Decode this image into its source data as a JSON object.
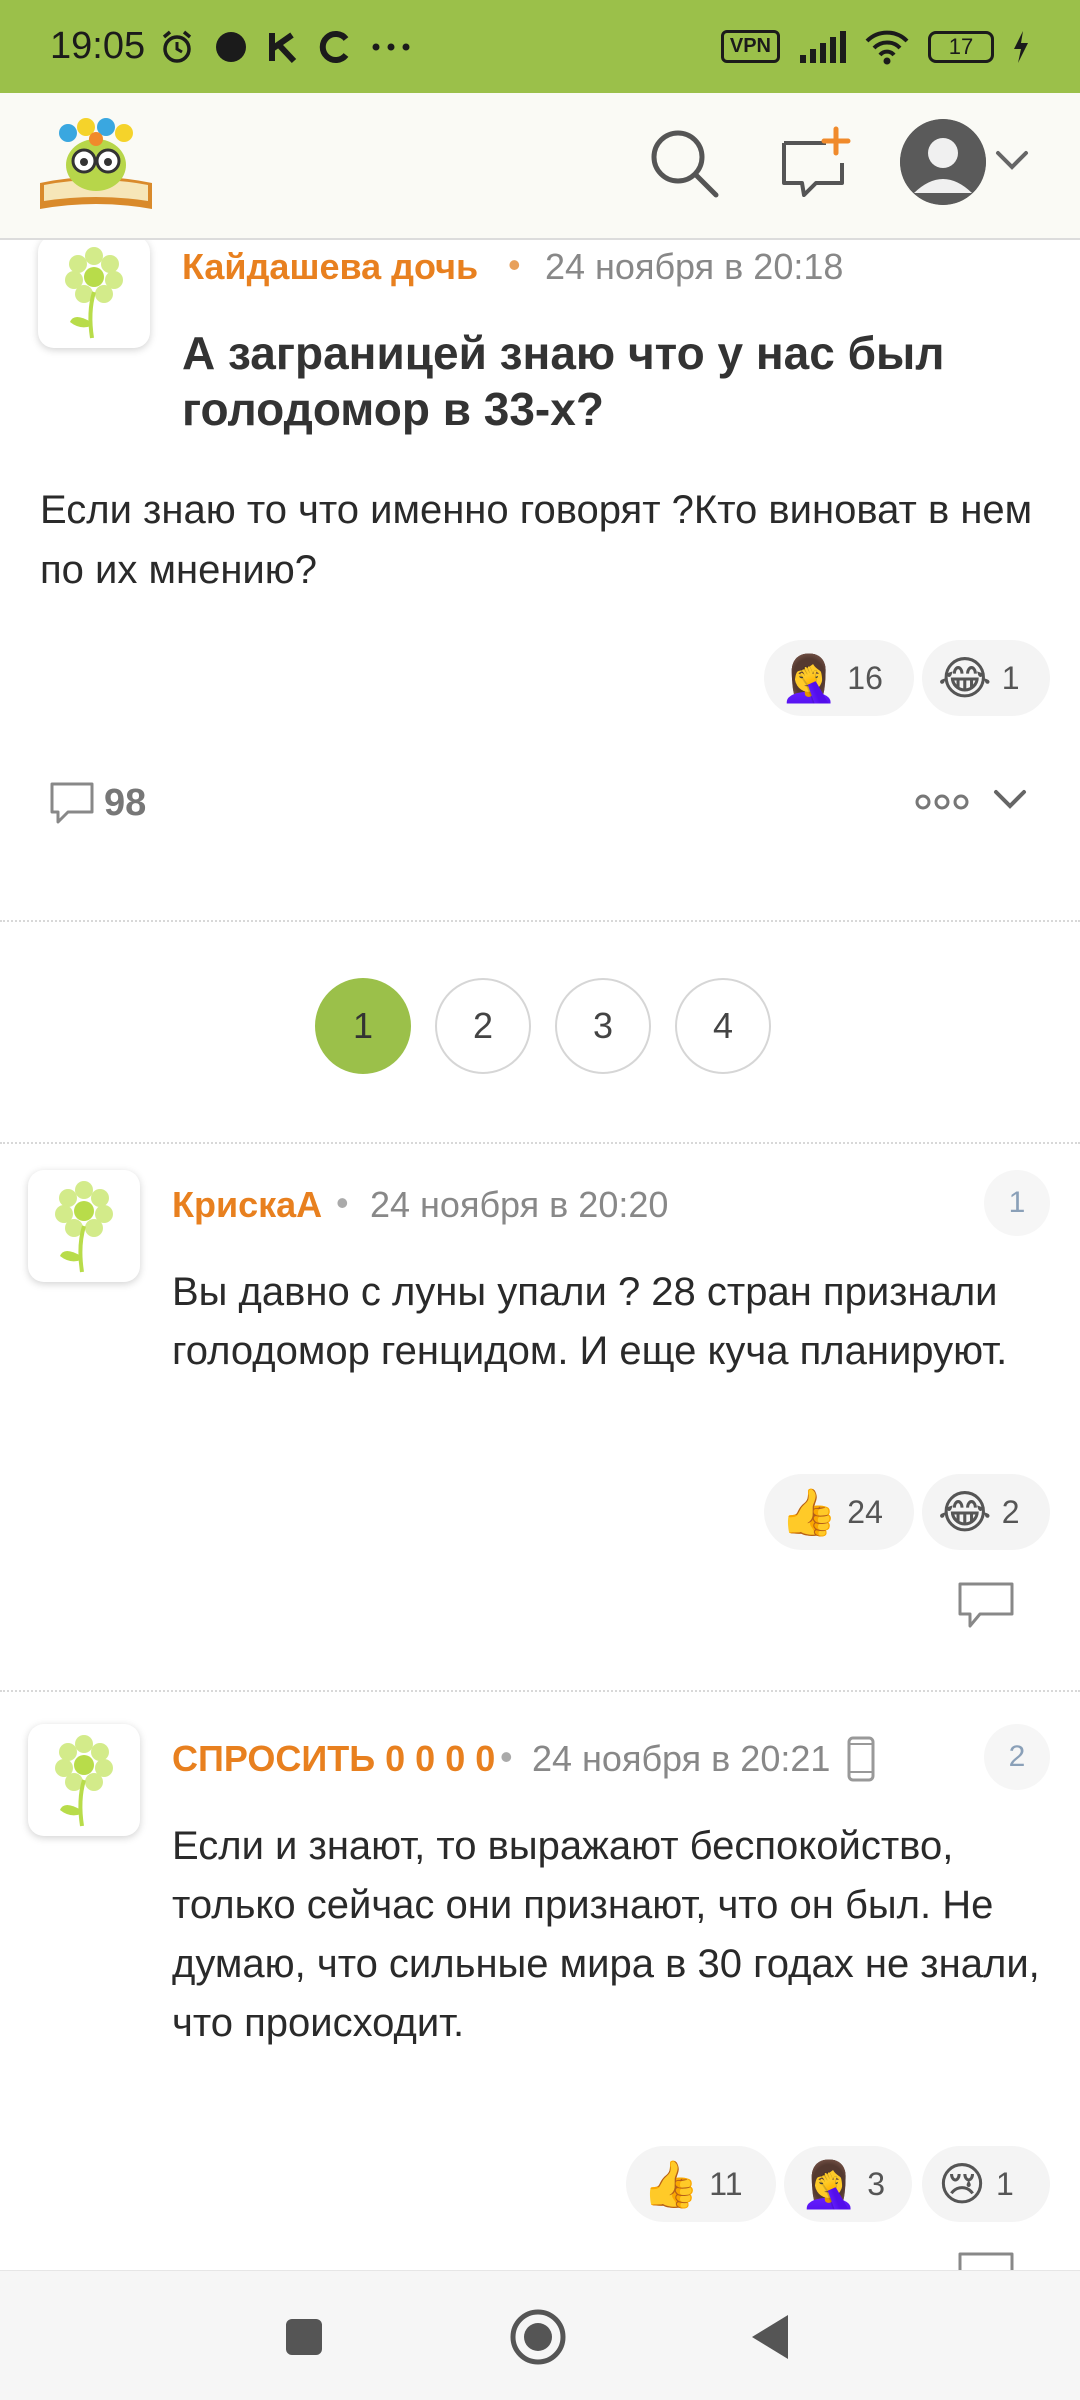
{
  "status_bar": {
    "time": "19:05",
    "left_icons": [
      "alarm-icon",
      "dot-icon",
      "k-icon",
      "c-icon",
      "more-dots-icon"
    ],
    "vpn_label": "VPN",
    "battery": "17"
  },
  "header": {
    "icons": [
      "logo",
      "search-icon",
      "ask-question-icon",
      "user-avatar",
      "chevron-down-icon"
    ]
  },
  "question": {
    "author": "Кайдашева дочь",
    "separator": "•",
    "date": "24 ноября в 20:18",
    "title": "А заграницей знаю что у нас был голодомор в 33-х?",
    "text": "Если знаю то что именно говорят ?Кто виноват в нем по их мнению?",
    "reactions": [
      {
        "emoji": "🤦‍♀️",
        "count": "16"
      },
      {
        "emoji": "😂",
        "count": "1"
      }
    ],
    "comments_count": "98"
  },
  "pagination": {
    "pages": [
      "1",
      "2",
      "3",
      "4"
    ],
    "active": "1"
  },
  "comments": [
    {
      "author": "КрискаА",
      "separator": "•",
      "date": "24 ноября в 20:20",
      "number": "1",
      "text": "Вы давно с луны упали ? 28 стран признали голодомор генцидом. И еще куча планируют.",
      "reactions": [
        {
          "emoji": "👍",
          "count": "24"
        },
        {
          "emoji": "😂",
          "count": "2"
        }
      ]
    },
    {
      "author": "СПРОСИТЬ 0 0 0 0",
      "separator": "•",
      "date": "24 ноября в 20:21",
      "number": "2",
      "device_icon": "mobile-phone-icon",
      "text": "Если и знают, то выражают беспокойство, только сейчас они признают, что он был. Не думаю, что сильные мира в 30 годах не знали, что происходит.",
      "reactions": [
        {
          "emoji": "👍",
          "count": "11"
        },
        {
          "emoji": "🤦‍♀️",
          "count": "3"
        },
        {
          "emoji": "😢",
          "count": "1"
        }
      ]
    }
  ],
  "nav_bar": {
    "buttons": [
      "recent-apps-button",
      "home-button",
      "back-button"
    ]
  },
  "colors": {
    "brand_green": "#9bc04a",
    "author_orange": "#e8801f"
  }
}
